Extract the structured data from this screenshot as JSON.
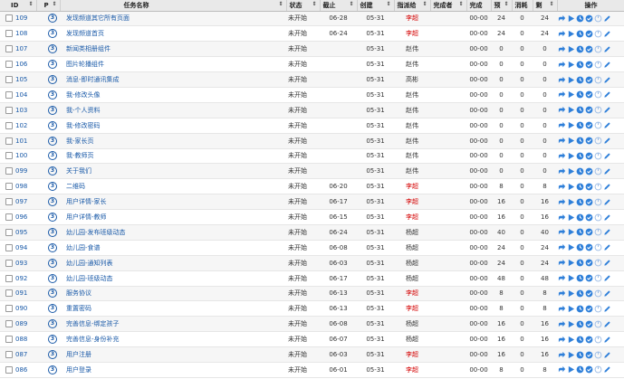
{
  "columns": {
    "id": "ID",
    "pri": "P",
    "name": "任务名称",
    "status": "状态",
    "deadline": "截止",
    "created": "创建",
    "assigned": "指派给",
    "finished_by": "完成者",
    "finished": "完成",
    "estimate": "预",
    "consumed": "消耗",
    "left": "剩",
    "actions": "操作"
  },
  "rows": [
    {
      "id": "109",
      "pri": "3",
      "name": "发现频道其它所有页面",
      "status": "未开始",
      "deadline": "06-28",
      "created": "05-31",
      "assigned": "李超",
      "finished_by": "",
      "finished": "00-00",
      "estimate": "24",
      "consumed": "0",
      "left": "24",
      "red": true
    },
    {
      "id": "108",
      "pri": "3",
      "name": "发现频道首页",
      "status": "未开始",
      "deadline": "06-24",
      "created": "05-31",
      "assigned": "李超",
      "finished_by": "",
      "finished": "00-00",
      "estimate": "24",
      "consumed": "0",
      "left": "24",
      "red": true
    },
    {
      "id": "107",
      "pri": "3",
      "name": "新闻类相册组件",
      "status": "未开始",
      "deadline": "",
      "created": "05-31",
      "assigned": "赵伟",
      "finished_by": "",
      "finished": "00-00",
      "estimate": "0",
      "consumed": "0",
      "left": "0",
      "red": false
    },
    {
      "id": "106",
      "pri": "3",
      "name": "图片轮播组件",
      "status": "未开始",
      "deadline": "",
      "created": "05-31",
      "assigned": "赵伟",
      "finished_by": "",
      "finished": "00-00",
      "estimate": "0",
      "consumed": "0",
      "left": "0",
      "red": false
    },
    {
      "id": "105",
      "pri": "3",
      "name": "消息-即时通讯集成",
      "status": "未开始",
      "deadline": "",
      "created": "05-31",
      "assigned": "高彬",
      "finished_by": "",
      "finished": "00-00",
      "estimate": "0",
      "consumed": "0",
      "left": "0",
      "red": false
    },
    {
      "id": "104",
      "pri": "3",
      "name": "我-修改头像",
      "status": "未开始",
      "deadline": "",
      "created": "05-31",
      "assigned": "赵伟",
      "finished_by": "",
      "finished": "00-00",
      "estimate": "0",
      "consumed": "0",
      "left": "0",
      "red": false
    },
    {
      "id": "103",
      "pri": "3",
      "name": "我-个人资料",
      "status": "未开始",
      "deadline": "",
      "created": "05-31",
      "assigned": "赵伟",
      "finished_by": "",
      "finished": "00-00",
      "estimate": "0",
      "consumed": "0",
      "left": "0",
      "red": false
    },
    {
      "id": "102",
      "pri": "3",
      "name": "我-修改密码",
      "status": "未开始",
      "deadline": "",
      "created": "05-31",
      "assigned": "赵伟",
      "finished_by": "",
      "finished": "00-00",
      "estimate": "0",
      "consumed": "0",
      "left": "0",
      "red": false
    },
    {
      "id": "101",
      "pri": "3",
      "name": "我-家长页",
      "status": "未开始",
      "deadline": "",
      "created": "05-31",
      "assigned": "赵伟",
      "finished_by": "",
      "finished": "00-00",
      "estimate": "0",
      "consumed": "0",
      "left": "0",
      "red": false
    },
    {
      "id": "100",
      "pri": "3",
      "name": "我-教师页",
      "status": "未开始",
      "deadline": "",
      "created": "05-31",
      "assigned": "赵伟",
      "finished_by": "",
      "finished": "00-00",
      "estimate": "0",
      "consumed": "0",
      "left": "0",
      "red": false
    },
    {
      "id": "099",
      "pri": "3",
      "name": "关于我们",
      "status": "未开始",
      "deadline": "",
      "created": "05-31",
      "assigned": "赵伟",
      "finished_by": "",
      "finished": "00-00",
      "estimate": "0",
      "consumed": "0",
      "left": "0",
      "red": false
    },
    {
      "id": "098",
      "pri": "3",
      "name": "二维码",
      "status": "未开始",
      "deadline": "06-20",
      "created": "05-31",
      "assigned": "李超",
      "finished_by": "",
      "finished": "00-00",
      "estimate": "8",
      "consumed": "0",
      "left": "8",
      "red": true
    },
    {
      "id": "097",
      "pri": "3",
      "name": "用户详情-家长",
      "status": "未开始",
      "deadline": "06-17",
      "created": "05-31",
      "assigned": "李超",
      "finished_by": "",
      "finished": "00-00",
      "estimate": "16",
      "consumed": "0",
      "left": "16",
      "red": true
    },
    {
      "id": "096",
      "pri": "3",
      "name": "用户详情-教师",
      "status": "未开始",
      "deadline": "06-15",
      "created": "05-31",
      "assigned": "李超",
      "finished_by": "",
      "finished": "00-00",
      "estimate": "16",
      "consumed": "0",
      "left": "16",
      "red": true
    },
    {
      "id": "095",
      "pri": "3",
      "name": "幼儿园-发布班级动态",
      "status": "未开始",
      "deadline": "06-24",
      "created": "05-31",
      "assigned": "杨超",
      "finished_by": "",
      "finished": "00-00",
      "estimate": "40",
      "consumed": "0",
      "left": "40",
      "red": false
    },
    {
      "id": "094",
      "pri": "3",
      "name": "幼儿园-食谱",
      "status": "未开始",
      "deadline": "06-08",
      "created": "05-31",
      "assigned": "杨超",
      "finished_by": "",
      "finished": "00-00",
      "estimate": "24",
      "consumed": "0",
      "left": "24",
      "red": false
    },
    {
      "id": "093",
      "pri": "3",
      "name": "幼儿园-通知列表",
      "status": "未开始",
      "deadline": "06-03",
      "created": "05-31",
      "assigned": "杨超",
      "finished_by": "",
      "finished": "00-00",
      "estimate": "24",
      "consumed": "0",
      "left": "24",
      "red": false
    },
    {
      "id": "092",
      "pri": "3",
      "name": "幼儿园-班级动态",
      "status": "未开始",
      "deadline": "06-17",
      "created": "05-31",
      "assigned": "杨超",
      "finished_by": "",
      "finished": "00-00",
      "estimate": "48",
      "consumed": "0",
      "left": "48",
      "red": false
    },
    {
      "id": "091",
      "pri": "3",
      "name": "服务协议",
      "status": "未开始",
      "deadline": "06-13",
      "created": "05-31",
      "assigned": "李超",
      "finished_by": "",
      "finished": "00-00",
      "estimate": "8",
      "consumed": "0",
      "left": "8",
      "red": true
    },
    {
      "id": "090",
      "pri": "3",
      "name": "重置密码",
      "status": "未开始",
      "deadline": "06-13",
      "created": "05-31",
      "assigned": "李超",
      "finished_by": "",
      "finished": "00-00",
      "estimate": "8",
      "consumed": "0",
      "left": "8",
      "red": true
    },
    {
      "id": "089",
      "pri": "3",
      "name": "完善信息-绑定孩子",
      "status": "未开始",
      "deadline": "06-08",
      "created": "05-31",
      "assigned": "杨超",
      "finished_by": "",
      "finished": "00-00",
      "estimate": "16",
      "consumed": "0",
      "left": "16",
      "red": false
    },
    {
      "id": "088",
      "pri": "3",
      "name": "完善信息-身份补充",
      "status": "未开始",
      "deadline": "06-07",
      "created": "05-31",
      "assigned": "杨超",
      "finished_by": "",
      "finished": "00-00",
      "estimate": "16",
      "consumed": "0",
      "left": "16",
      "red": false
    },
    {
      "id": "087",
      "pri": "3",
      "name": "用户注册",
      "status": "未开始",
      "deadline": "06-03",
      "created": "05-31",
      "assigned": "李超",
      "finished_by": "",
      "finished": "00-00",
      "estimate": "16",
      "consumed": "0",
      "left": "16",
      "red": true
    },
    {
      "id": "086",
      "pri": "3",
      "name": "用户登录",
      "status": "未开始",
      "deadline": "06-01",
      "created": "05-31",
      "assigned": "李超",
      "finished_by": "",
      "finished": "00-00",
      "estimate": "8",
      "consumed": "0",
      "left": "8",
      "red": true
    }
  ],
  "action_icons": [
    "assign-icon",
    "start-icon",
    "record-icon",
    "finish-icon",
    "close-icon",
    "edit-icon"
  ],
  "colors": {
    "link": "#1a5aa8",
    "assignee_red": "#d40000",
    "icon_blue": "#2e7fd9",
    "header_bg": "#e9e9e9"
  }
}
